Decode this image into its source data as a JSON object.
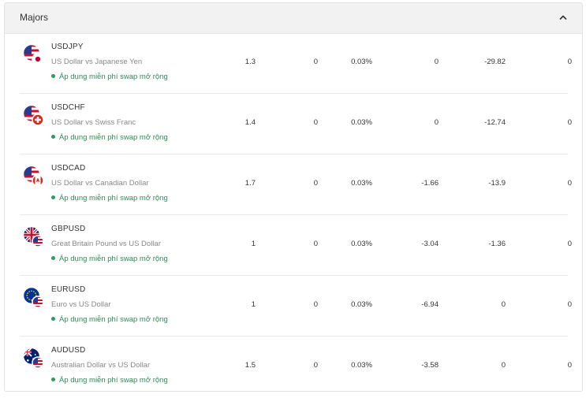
{
  "section": {
    "title": "Majors",
    "collapse_icon": "chevron-up-icon"
  },
  "swap_note": "Áp dụng miễn phí swap mở rộng",
  "colors": {
    "swap_green": "#2e8b57",
    "header_bg": "#f2f2f2"
  },
  "rows": [
    {
      "symbol": "USDJPY",
      "description": "US Dollar vs Japanese Yen",
      "flags": [
        "us-flag-icon",
        "jp-flag-icon"
      ],
      "values": [
        "1.3",
        "0",
        "0.03%",
        "0",
        "-29.82",
        "0"
      ]
    },
    {
      "symbol": "USDCHF",
      "description": "US Dollar vs Swiss Franc",
      "flags": [
        "us-flag-icon",
        "ch-flag-icon"
      ],
      "values": [
        "1.4",
        "0",
        "0.03%",
        "0",
        "-12.74",
        "0"
      ]
    },
    {
      "symbol": "USDCAD",
      "description": "US Dollar vs Canadian Dollar",
      "flags": [
        "us-flag-icon",
        "ca-flag-icon"
      ],
      "values": [
        "1.7",
        "0",
        "0.03%",
        "-1.66",
        "-13.9",
        "0"
      ]
    },
    {
      "symbol": "GBPUSD",
      "description": "Great Britain Pound vs US Dollar",
      "flags": [
        "gb-flag-icon",
        "us-flag-icon"
      ],
      "values": [
        "1",
        "0",
        "0.03%",
        "-3.04",
        "-1.36",
        "0"
      ]
    },
    {
      "symbol": "EURUSD",
      "description": "Euro vs US Dollar",
      "flags": [
        "eu-flag-icon",
        "us-flag-icon"
      ],
      "values": [
        "1",
        "0",
        "0.03%",
        "-6.94",
        "0",
        "0"
      ]
    },
    {
      "symbol": "AUDUSD",
      "description": "Australian Dollar vs US Dollar",
      "flags": [
        "au-flag-icon",
        "us-flag-icon"
      ],
      "values": [
        "1.5",
        "0",
        "0.03%",
        "-3.58",
        "0",
        "0"
      ]
    }
  ]
}
